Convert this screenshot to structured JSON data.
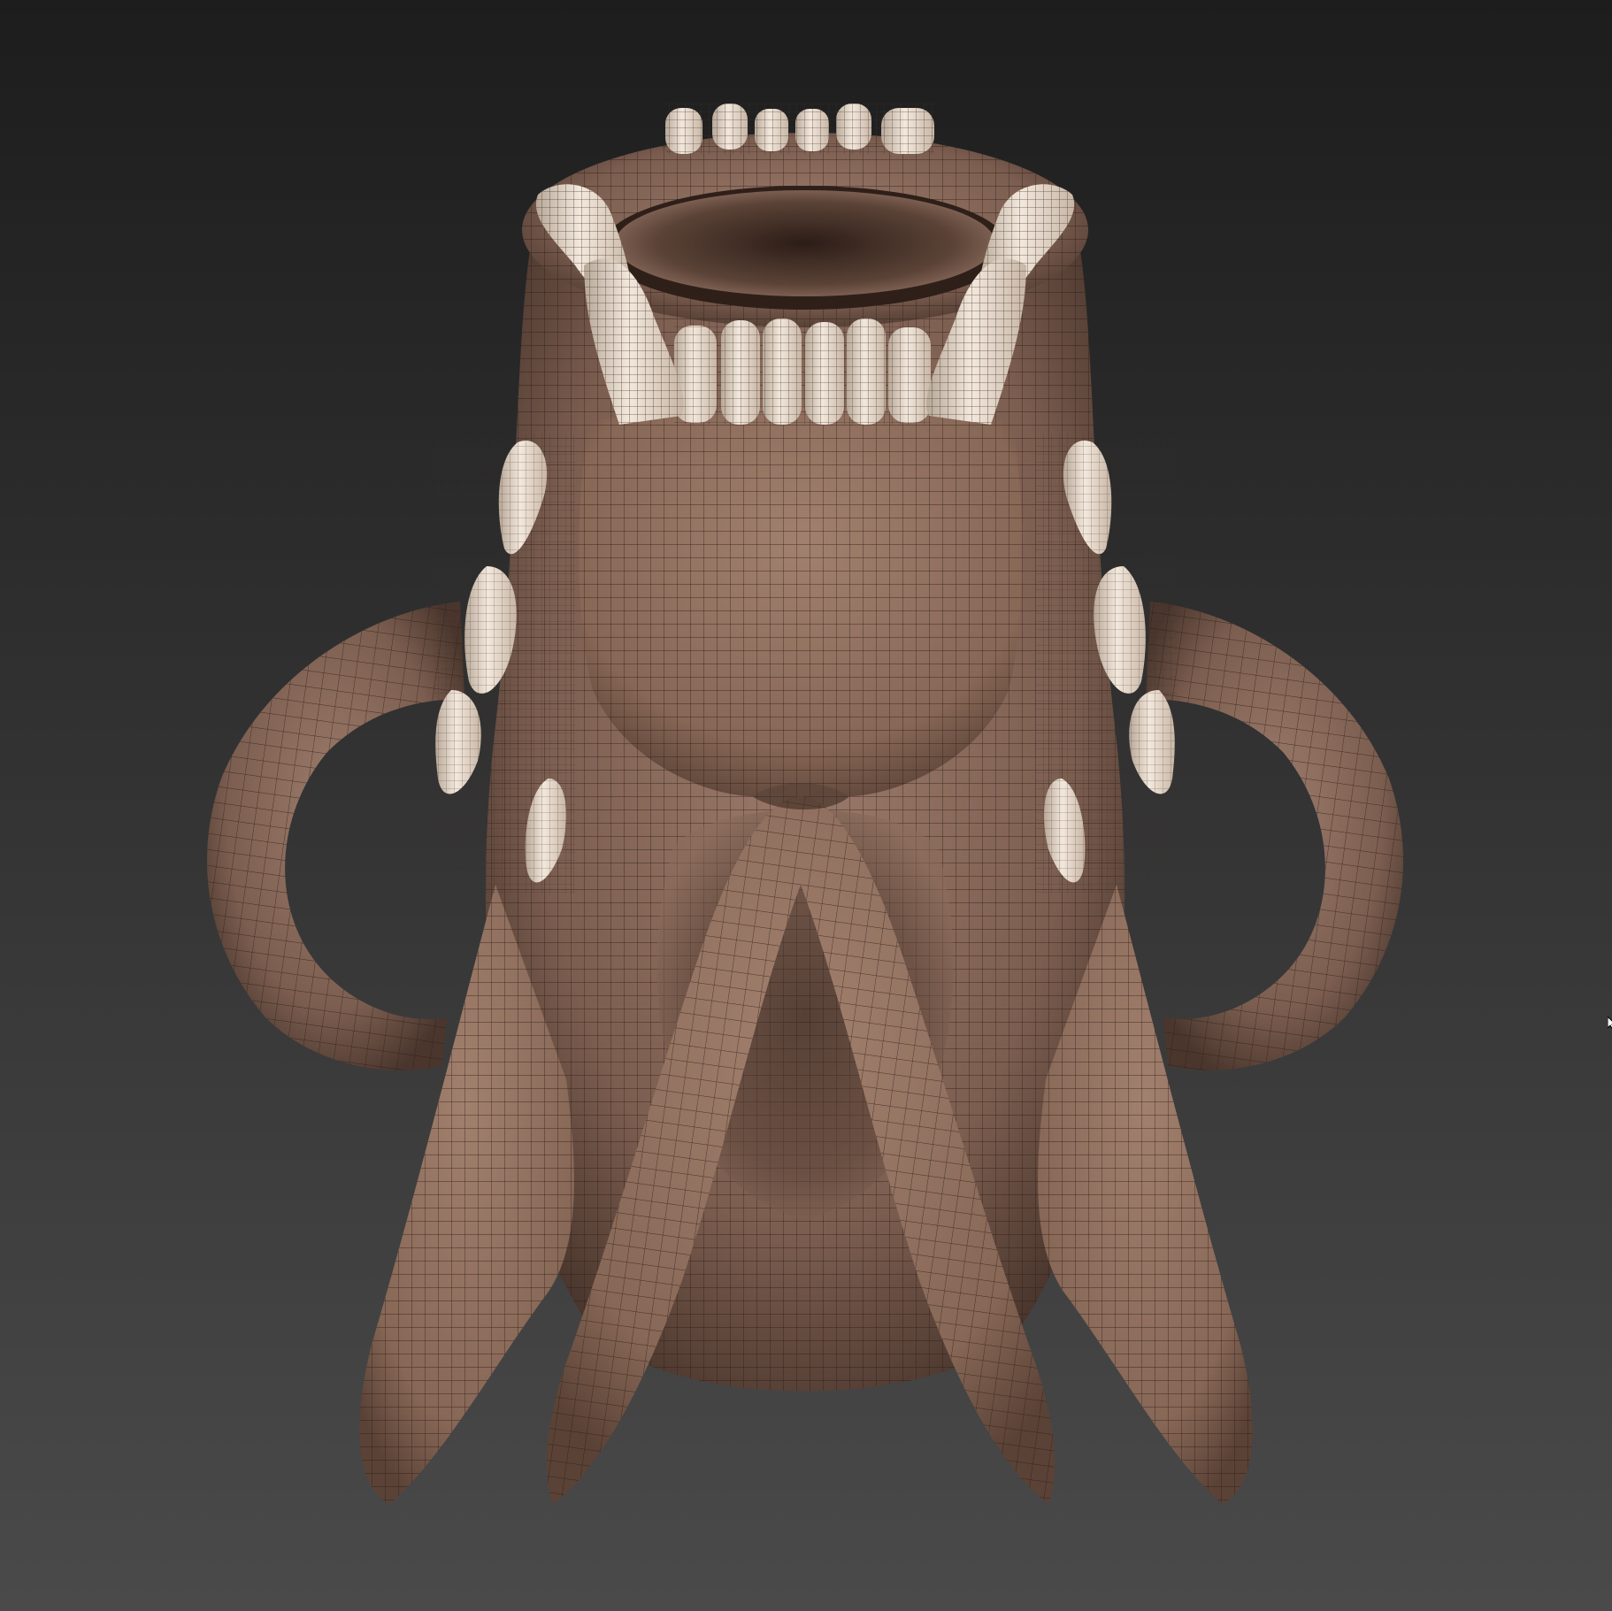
{
  "viewport": {
    "view_mode": "wireframe-on-shaded",
    "background_top_color": "#1d1d1d",
    "background_bottom_color": "#4a4a4a"
  },
  "model": {
    "subject": "skull",
    "bone_color": "#8a6b5c",
    "bone_shadow_color": "#4a362d",
    "teeth_color": "#e4d6c8",
    "wireframe_color": "#2a1a14"
  },
  "cursor": {
    "icon": "arrow-cursor-icon"
  }
}
